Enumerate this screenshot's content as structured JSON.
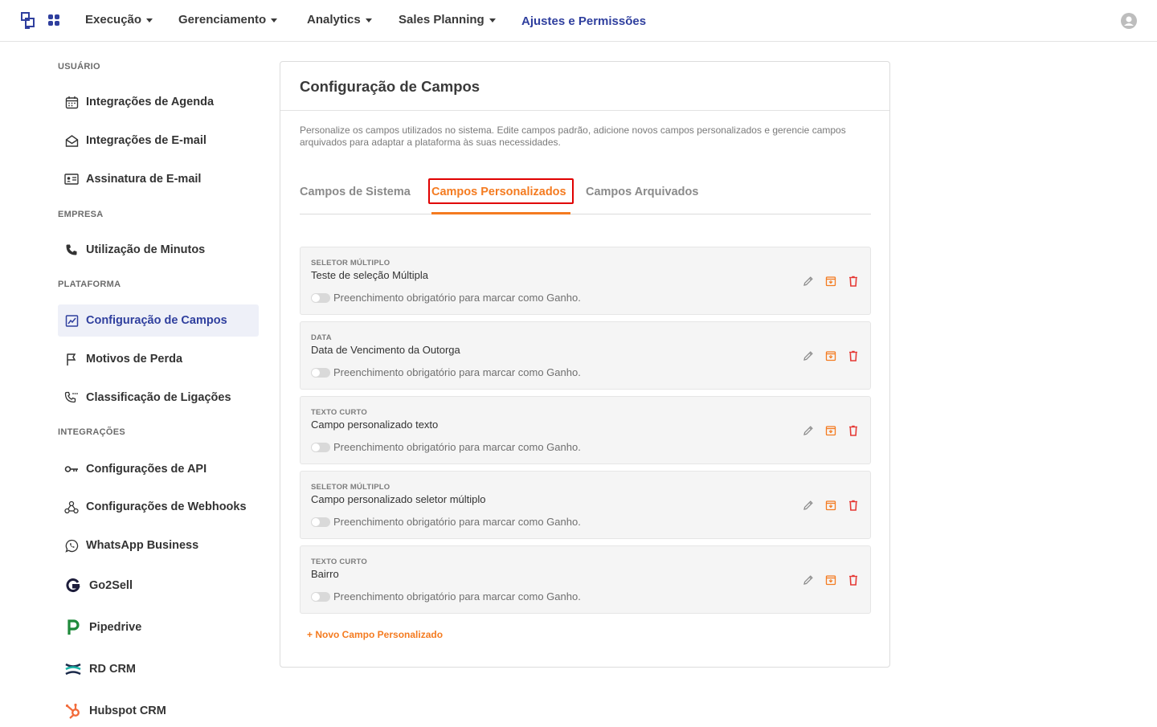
{
  "nav": {
    "items": [
      {
        "label": "Execução"
      },
      {
        "label": "Gerenciamento"
      },
      {
        "label": "Analytics"
      },
      {
        "label": "Sales Planning"
      }
    ],
    "active_label": "Ajustes e Permissões"
  },
  "sidebar": {
    "sections": [
      {
        "title": "USUÁRIO"
      },
      {
        "title": "EMPRESA"
      },
      {
        "title": "PLATAFORMA"
      },
      {
        "title": "INTEGRAÇÕES"
      }
    ],
    "items": [
      {
        "label": "Integrações de Agenda",
        "icon": "calendar-icon"
      },
      {
        "label": "Integrações de E-mail",
        "icon": "envelope-icon"
      },
      {
        "label": "Assinatura de E-mail",
        "icon": "signature-card-icon"
      },
      {
        "label": "Utilização de Minutos",
        "icon": "phone-icon"
      },
      {
        "label": "Configuração de Campos",
        "icon": "form-edit-icon",
        "active": true
      },
      {
        "label": "Motivos de Perda",
        "icon": "flag-icon"
      },
      {
        "label": "Classificação de Ligações",
        "icon": "phone-rating-icon"
      },
      {
        "label": "Configurações de API",
        "icon": "key-icon"
      },
      {
        "label": "Configurações de Webhooks",
        "icon": "webhook-icon"
      },
      {
        "label": "WhatsApp Business",
        "icon": "whatsapp-icon"
      },
      {
        "label": "Go2Sell",
        "icon": "go2sell-logo-icon"
      },
      {
        "label": "Pipedrive",
        "icon": "pipedrive-logo-icon"
      },
      {
        "label": "RD CRM",
        "icon": "rdcrm-logo-icon"
      },
      {
        "label": "Hubspot CRM",
        "icon": "hubspot-logo-icon"
      }
    ]
  },
  "card": {
    "title": "Configuração de Campos",
    "description": "Personalize os campos utilizados no sistema. Edite campos padrão, adicione novos campos personalizados e gerencie campos arquivados para adaptar a plataforma às suas necessidades.",
    "tabs": [
      {
        "label": "Campos de Sistema"
      },
      {
        "label": "Campos Personalizados",
        "active": true
      },
      {
        "label": "Campos Arquivados"
      }
    ],
    "fields": [
      {
        "type": "SELETOR MÚLTIPLO",
        "name": "Teste de seleção Múltipla",
        "toggle_label": "Preenchimento obrigatório para marcar como Ganho.",
        "required": false
      },
      {
        "type": "DATA",
        "name": "Data de Vencimento da Outorga",
        "toggle_label": "Preenchimento obrigatório para marcar como Ganho.",
        "required": false
      },
      {
        "type": "TEXTO CURTO",
        "name": "Campo personalizado texto",
        "toggle_label": "Preenchimento obrigatório para marcar como Ganho.",
        "required": false
      },
      {
        "type": "SELETOR MÚLTIPLO",
        "name": "Campo personalizado seletor múltiplo",
        "toggle_label": "Preenchimento obrigatório para marcar como Ganho.",
        "required": false
      },
      {
        "type": "TEXTO CURTO",
        "name": "Bairro",
        "toggle_label": "Preenchimento obrigatório para marcar como Ganho.",
        "required": false
      }
    ],
    "new_field_label": "+ Novo Campo Personalizado"
  },
  "colors": {
    "accent_orange": "#f47b20",
    "brand_blue": "#2f3f9e",
    "delete_red": "#e53935",
    "highlight_red": "#e00000"
  }
}
